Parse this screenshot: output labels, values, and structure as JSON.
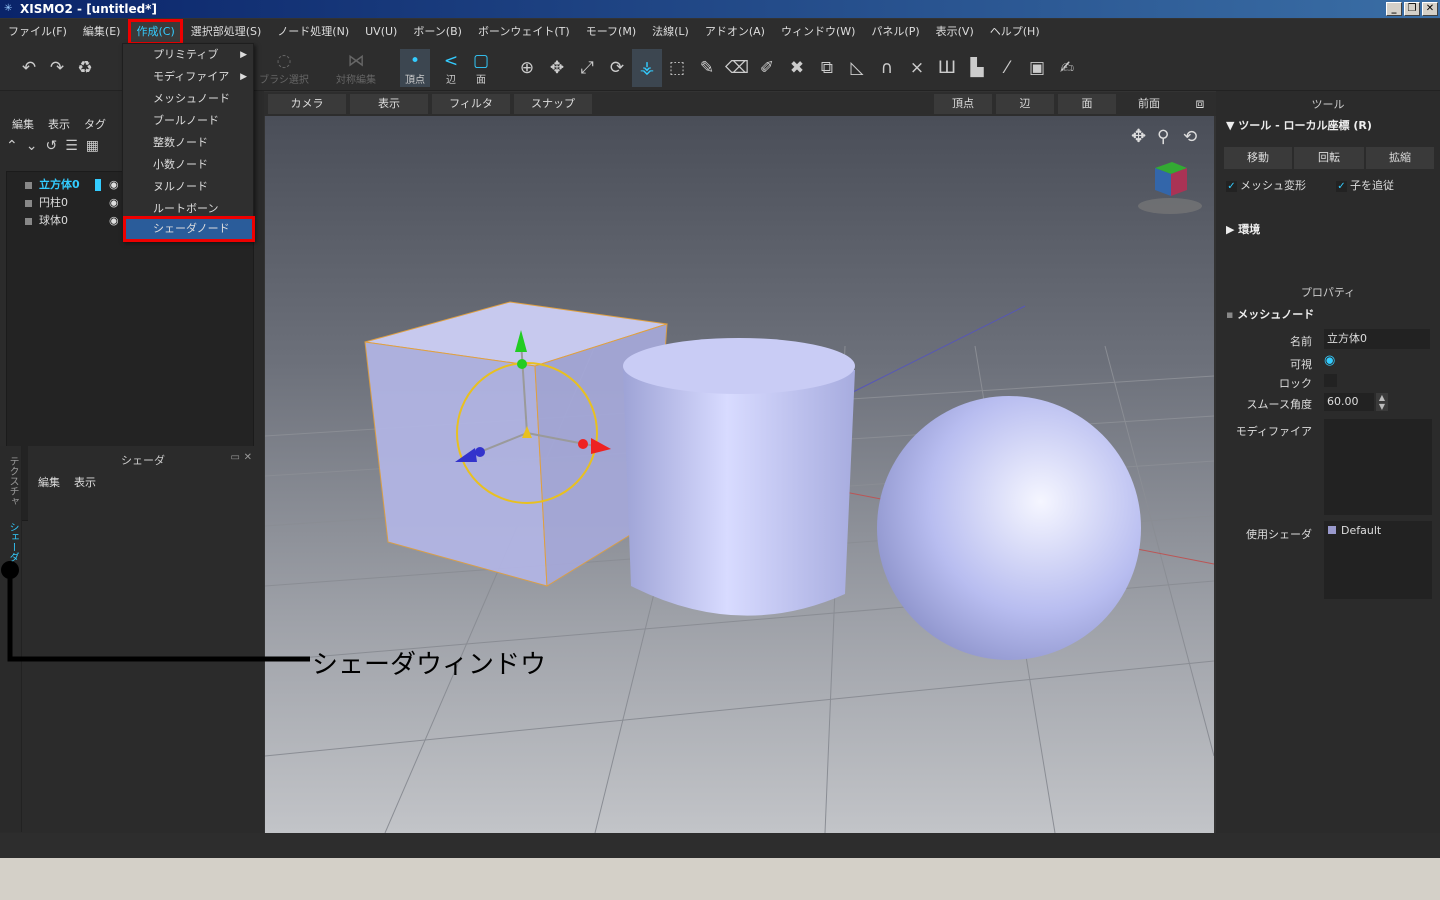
{
  "window": {
    "title": "XISMO2 - [untitled*]"
  },
  "menu": [
    "ファイル(F)",
    "編集(E)",
    "作成(C)",
    "選択部処理(S)",
    "ノード処理(N)",
    "UV(U)",
    "ボーン(B)",
    "ボーンウェイト(T)",
    "モーフ(M)",
    "法線(L)",
    "アドオン(A)",
    "ウィンドウ(W)",
    "パネル(P)",
    "表示(V)",
    "ヘルプ(H)"
  ],
  "active_menu_index": 2,
  "dropdown": {
    "items": [
      "プリミティブ",
      "モディファイア",
      "メッシュノード",
      "ブールノード",
      "整数ノード",
      "小数ノード",
      "ヌルノード",
      "ルートボーン",
      "シェーダノード"
    ],
    "highlighted": "シェーダノード"
  },
  "toolbar": {
    "brush_select": "ブラシ選択",
    "symmetric_edit": "対称編集",
    "vertex": "頂点",
    "edge": "辺",
    "face": "面"
  },
  "scene_panel": {
    "menu": [
      "編集",
      "表示",
      "タグ"
    ],
    "nodes": [
      {
        "name": "立方体0",
        "selected": true
      },
      {
        "name": "円柱0",
        "selected": false
      },
      {
        "name": "球体0",
        "selected": false
      }
    ]
  },
  "shader_panel": {
    "title": "シェーダ",
    "menu": [
      "編集",
      "表示"
    ]
  },
  "side_tabs": {
    "texture": "テクスチャ",
    "shader": "シェーダ"
  },
  "viewport_bar": {
    "camera": "カメラ",
    "display": "表示",
    "filter": "フィルタ",
    "snap": "スナップ",
    "vertex": "頂点",
    "edge": "辺",
    "face": "面",
    "view": "前面"
  },
  "tool_panel": {
    "title": "ツール",
    "header": "ツール - ローカル座標 (R)",
    "buttons": [
      "移動",
      "回転",
      "拡縮"
    ],
    "mesh_deform": "メッシュ変形",
    "follow_children": "子を追従",
    "env": "環境"
  },
  "property_panel": {
    "title": "プロパティ",
    "header": "メッシュノード",
    "name_label": "名前",
    "name_value": "立方体0",
    "visible_label": "可視",
    "lock_label": "ロック",
    "smooth_label": "スムース角度",
    "smooth_value": "60.00",
    "modifier_label": "モディファイア",
    "shader_label": "使用シェーダ",
    "shader_value": "Default"
  },
  "annotation": {
    "label": "シェーダウィンドウ"
  },
  "colors": {
    "accent": "#33ccff",
    "highlight_box": "#ee0000",
    "selection": "#2a5c9a"
  }
}
